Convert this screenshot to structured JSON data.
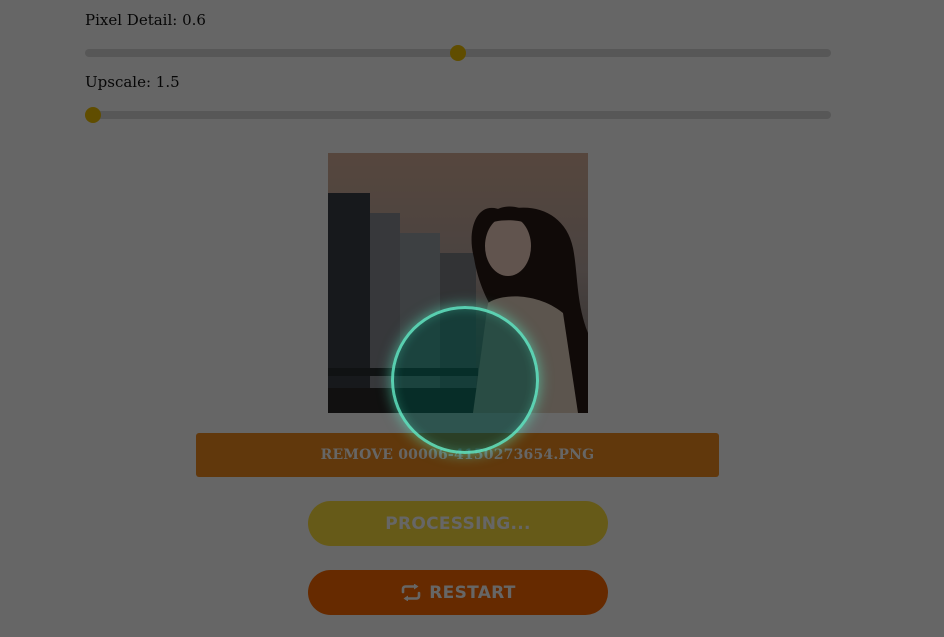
{
  "sliders": [
    {
      "label": "Pixel Detail: 0.6",
      "value": 0.6,
      "fraction": 0.5
    },
    {
      "label": "Upscale: 1.5",
      "value": 1.5,
      "fraction": 0.0
    }
  ],
  "image": {
    "alt": "uploaded photo"
  },
  "remove_button": {
    "label": "REMOVE 00006-4150273654.PNG"
  },
  "processing_button": {
    "label": "PROCESSING..."
  },
  "restart_button": {
    "label": "RESTART",
    "icon": "repeat-icon"
  },
  "overlay": {
    "spinner_icon": "loading-spinner-icon"
  },
  "colors": {
    "slider_thumb": "#f0c000",
    "remove_button": "#f28d1e",
    "processing_button": "#ffe03c",
    "restart_button": "#ff6a00",
    "spinner_ring": "#6effd7"
  }
}
